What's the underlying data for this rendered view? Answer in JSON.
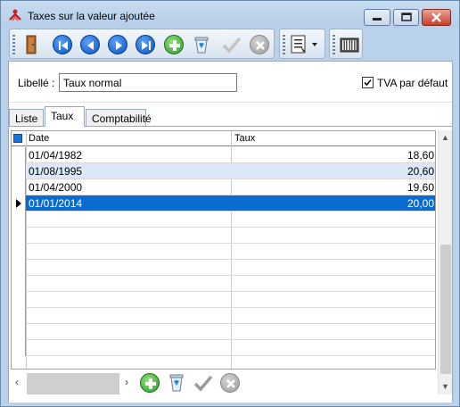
{
  "window": {
    "title": "Taxes sur la valeur ajoutée",
    "buttons": [
      "minimize",
      "maximize",
      "close"
    ]
  },
  "toolbar": {
    "groups": [
      {
        "name": "navigation",
        "items": [
          {
            "icon": "exit-door-icon",
            "enabled": true
          },
          {
            "icon": "first-record-icon",
            "enabled": true
          },
          {
            "icon": "previous-record-icon",
            "enabled": true
          },
          {
            "icon": "next-record-icon",
            "enabled": true
          },
          {
            "icon": "last-record-icon",
            "enabled": true
          },
          {
            "icon": "add-record-icon",
            "enabled": true
          },
          {
            "icon": "delete-record-icon",
            "enabled": true
          },
          {
            "icon": "validate-icon",
            "enabled": false
          },
          {
            "icon": "cancel-icon",
            "enabled": false
          }
        ]
      },
      {
        "name": "reports",
        "items": [
          {
            "icon": "report-dropdown-icon",
            "enabled": true
          }
        ]
      },
      {
        "name": "barcode",
        "items": [
          {
            "icon": "barcode-icon",
            "enabled": true
          }
        ]
      }
    ]
  },
  "form": {
    "libelle_label": "Libellé :",
    "libelle_value": "Taux normal",
    "tva_default_label": "TVA par défaut",
    "tva_default_checked": true
  },
  "tabs": [
    {
      "label": "Liste",
      "active": false
    },
    {
      "label": "Taux",
      "active": true
    },
    {
      "label": "Comptabilité",
      "active": false
    }
  ],
  "grid": {
    "columns": [
      "Date",
      "Taux"
    ],
    "rows": [
      {
        "date": "01/04/1982",
        "taux": "18,60",
        "state": "normal"
      },
      {
        "date": "01/08/1995",
        "taux": "20,60",
        "state": "alt"
      },
      {
        "date": "01/04/2000",
        "taux": "19,60",
        "state": "normal"
      },
      {
        "date": "01/01/2014",
        "taux": "20,00",
        "state": "selected"
      }
    ],
    "empty_rows": 9
  },
  "colors": {
    "selection": "#0a6cd0",
    "alt_row": "#dce8f8",
    "window_frame": "#b9d1ea"
  }
}
